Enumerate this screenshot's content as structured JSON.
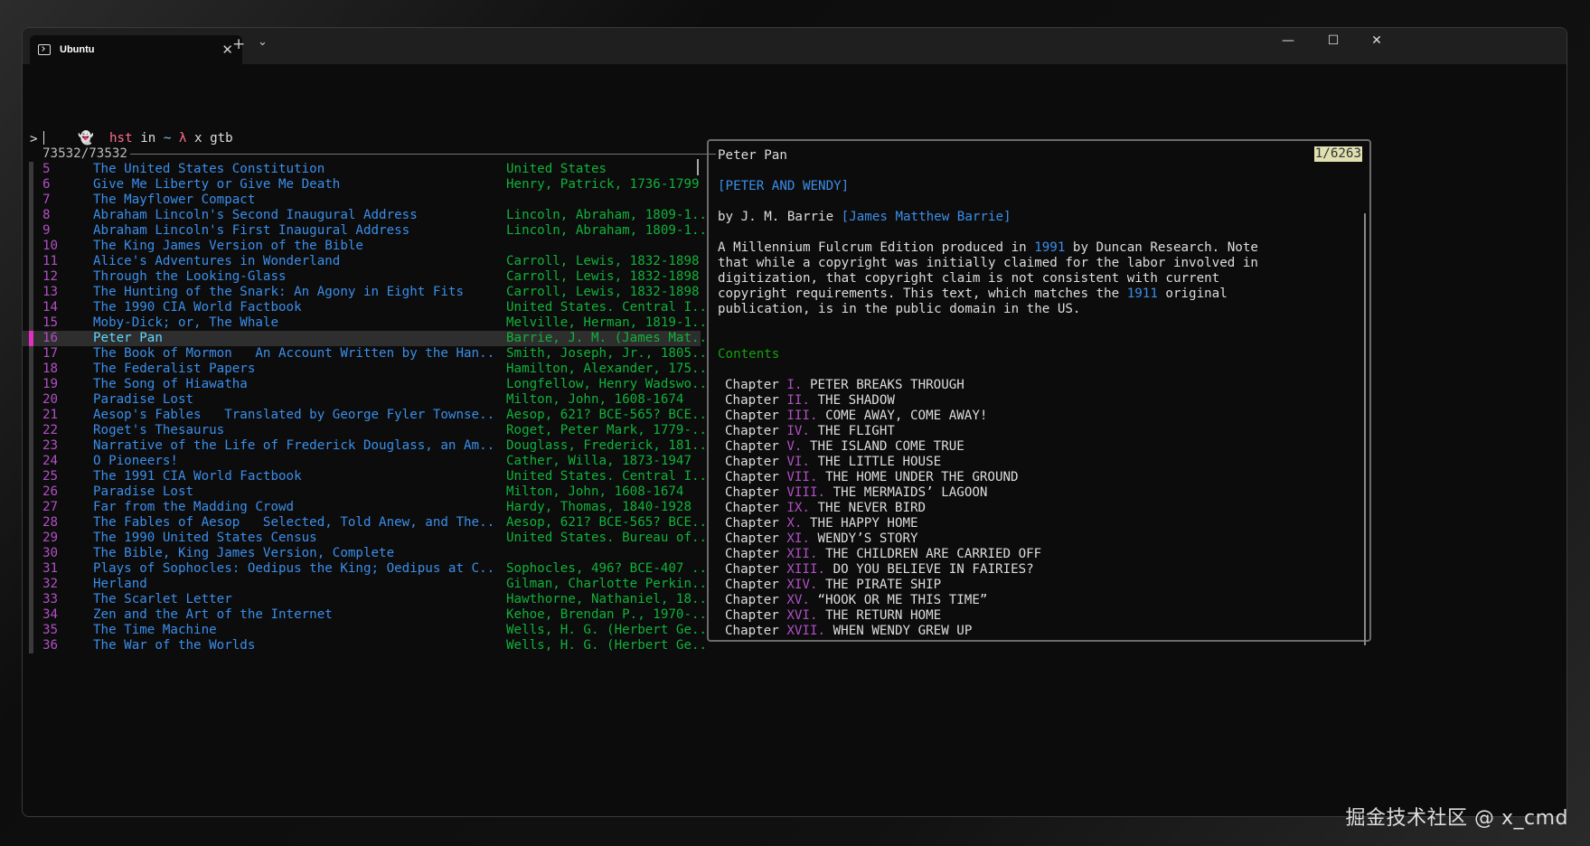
{
  "window": {
    "tab_title": "Ubuntu",
    "tab_close": "✕",
    "new_tab": "+",
    "dropdown": "⌄",
    "minimize": "—",
    "maximize": "☐",
    "close": "✕"
  },
  "prompt": {
    "icon": "ghost-icon",
    "user": "hst",
    "in": "in",
    "dir": "~",
    "lambda": "λ",
    "command": "x gtb",
    "input_marker": ">"
  },
  "list": {
    "counter": "73532/73532",
    "selected_index": 11,
    "rows": [
      {
        "num": "5",
        "title": "The United States Constitution",
        "author": "United States"
      },
      {
        "num": "6",
        "title": "Give Me Liberty or Give Me Death",
        "author": "Henry, Patrick, 1736-1799"
      },
      {
        "num": "7",
        "title": "The Mayflower Compact",
        "author": ""
      },
      {
        "num": "8",
        "title": "Abraham Lincoln's Second Inaugural Address",
        "author": "Lincoln, Abraham, 1809-1.."
      },
      {
        "num": "9",
        "title": "Abraham Lincoln's First Inaugural Address",
        "author": "Lincoln, Abraham, 1809-1.."
      },
      {
        "num": "10",
        "title": "The King James Version of the Bible",
        "author": ""
      },
      {
        "num": "11",
        "title": "Alice's Adventures in Wonderland",
        "author": "Carroll, Lewis, 1832-1898"
      },
      {
        "num": "12",
        "title": "Through the Looking-Glass",
        "author": "Carroll, Lewis, 1832-1898"
      },
      {
        "num": "13",
        "title": "The Hunting of the Snark: An Agony in Eight Fits",
        "author": "Carroll, Lewis, 1832-1898"
      },
      {
        "num": "14",
        "title": "The 1990 CIA World Factbook",
        "author": "United States. Central I.."
      },
      {
        "num": "15",
        "title": "Moby-Dick; or, The Whale",
        "author": "Melville, Herman, 1819-1.."
      },
      {
        "num": "16",
        "title": "Peter Pan",
        "author": "Barrie, J. M. (James Mat.."
      },
      {
        "num": "17",
        "title": "The Book of Mormon   An Account Written by the Han..",
        "author": "Smith, Joseph, Jr., 1805.."
      },
      {
        "num": "18",
        "title": "The Federalist Papers",
        "author": "Hamilton, Alexander, 175.."
      },
      {
        "num": "19",
        "title": "The Song of Hiawatha",
        "author": "Longfellow, Henry Wadswo.."
      },
      {
        "num": "20",
        "title": "Paradise Lost",
        "author": "Milton, John, 1608-1674"
      },
      {
        "num": "21",
        "title": "Aesop's Fables   Translated by George Fyler Townse..",
        "author": "Aesop, 621? BCE-565? BCE.."
      },
      {
        "num": "22",
        "title": "Roget's Thesaurus",
        "author": "Roget, Peter Mark, 1779-.."
      },
      {
        "num": "23",
        "title": "Narrative of the Life of Frederick Douglass, an Am..",
        "author": "Douglass, Frederick, 181.."
      },
      {
        "num": "24",
        "title": "O Pioneers!",
        "author": "Cather, Willa, 1873-1947"
      },
      {
        "num": "25",
        "title": "The 1991 CIA World Factbook",
        "author": "United States. Central I.."
      },
      {
        "num": "26",
        "title": "Paradise Lost",
        "author": "Milton, John, 1608-1674"
      },
      {
        "num": "27",
        "title": "Far from the Madding Crowd",
        "author": "Hardy, Thomas, 1840-1928"
      },
      {
        "num": "28",
        "title": "The Fables of Aesop   Selected, Told Anew, and The..",
        "author": "Aesop, 621? BCE-565? BCE.."
      },
      {
        "num": "29",
        "title": "The 1990 United States Census",
        "author": "United States. Bureau of.."
      },
      {
        "num": "30",
        "title": "The Bible, King James Version, Complete",
        "author": ""
      },
      {
        "num": "31",
        "title": "Plays of Sophocles: Oedipus the King; Oedipus at C..",
        "author": "Sophocles, 496? BCE-407 .."
      },
      {
        "num": "32",
        "title": "Herland",
        "author": "Gilman, Charlotte Perkin.."
      },
      {
        "num": "33",
        "title": "The Scarlet Letter",
        "author": "Hawthorne, Nathaniel, 18.."
      },
      {
        "num": "34",
        "title": "Zen and the Art of the Internet",
        "author": "Kehoe, Brendan P., 1970-.."
      },
      {
        "num": "35",
        "title": "The Time Machine",
        "author": "Wells, H. G. (Herbert Ge.."
      },
      {
        "num": "36",
        "title": "The War of the Worlds",
        "author": "Wells, H. G. (Herbert Ge.."
      }
    ]
  },
  "preview": {
    "title": "Peter Pan",
    "position": "1/6263",
    "subtitle": "[PETER AND WENDY]",
    "by_prefix": "by J. M. Barrie ",
    "by_full": "[James Matthew Barrie]",
    "para": [
      [
        {
          "t": "A Millennium Fulcrum Edition produced in "
        },
        {
          "t": "1991",
          "c": "blue"
        },
        {
          "t": " by Duncan Research. Note"
        }
      ],
      [
        {
          "t": "that while a copyright was initially claimed for the labor involved in"
        }
      ],
      [
        {
          "t": "digitization, that copyright claim is not consistent with current"
        }
      ],
      [
        {
          "t": "copyright requirements. This text, which matches the "
        },
        {
          "t": "1911",
          "c": "blue"
        },
        {
          "t": " original"
        }
      ],
      [
        {
          "t": "publication, is in the public domain in the US."
        }
      ]
    ],
    "contents_label": "Contents",
    "chapter_word": "Chapter",
    "chapters": [
      {
        "n": "I.",
        "t": "PETER BREAKS THROUGH"
      },
      {
        "n": "II.",
        "t": "THE SHADOW"
      },
      {
        "n": "III.",
        "t": "COME AWAY, COME AWAY!"
      },
      {
        "n": "IV.",
        "t": "THE FLIGHT"
      },
      {
        "n": "V.",
        "t": "THE ISLAND COME TRUE"
      },
      {
        "n": "VI.",
        "t": "THE LITTLE HOUSE"
      },
      {
        "n": "VII.",
        "t": "THE HOME UNDER THE GROUND"
      },
      {
        "n": "VIII.",
        "t": "THE MERMAIDS’ LAGOON"
      },
      {
        "n": "IX.",
        "t": "THE NEVER BIRD"
      },
      {
        "n": "X.",
        "t": "THE HAPPY HOME"
      },
      {
        "n": "XI.",
        "t": "WENDY’S STORY"
      },
      {
        "n": "XII.",
        "t": "THE CHILDREN ARE CARRIED OFF"
      },
      {
        "n": "XIII.",
        "t": "DO YOU BELIEVE IN FAIRIES?"
      },
      {
        "n": "XIV.",
        "t": "THE PIRATE SHIP"
      },
      {
        "n": "XV.",
        "t": "“HOOK OR ME THIS TIME”"
      },
      {
        "n": "XVI.",
        "t": "THE RETURN HOME"
      },
      {
        "n": "XVII.",
        "t": "WHEN WENDY GREW UP"
      }
    ]
  },
  "watermark": "掘金技术社区 @ x_cmd"
}
